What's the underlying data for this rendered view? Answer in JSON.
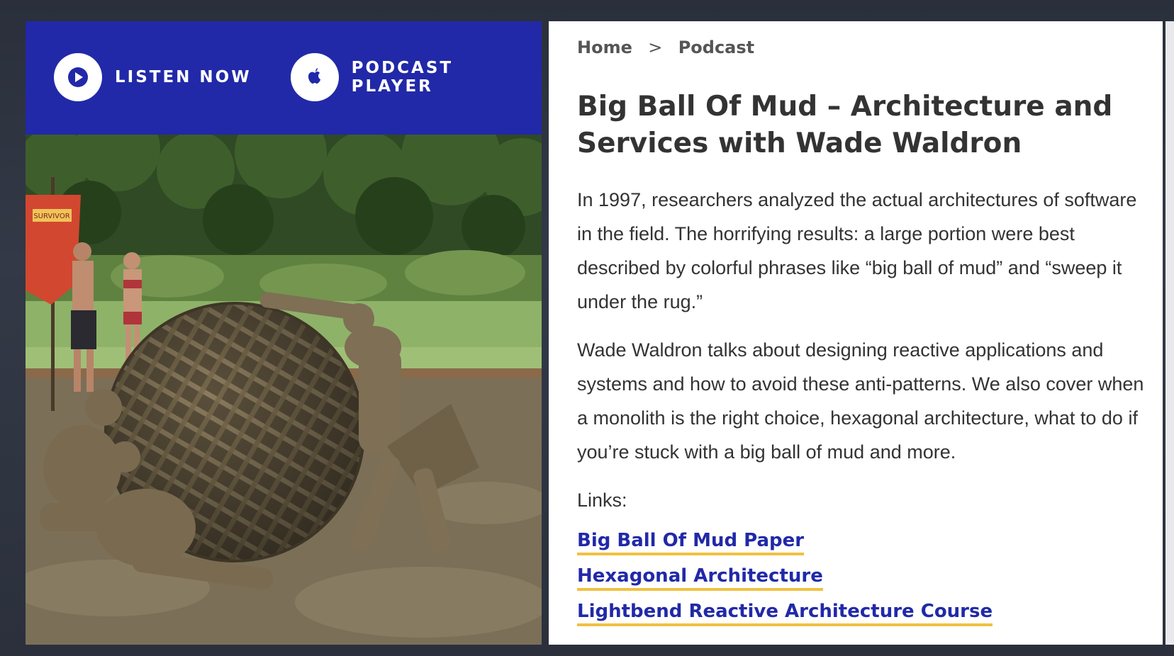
{
  "player": {
    "listen_label": "LISTEN NOW",
    "podcast_label": "PODCAST PLAYER",
    "accent_color": "#2129a8"
  },
  "breadcrumb": {
    "home": "Home",
    "separator": ">",
    "current": "Podcast"
  },
  "article": {
    "title": "Big Ball Of Mud – Architecture and Services with Wade Waldron",
    "paragraph1": "In 1997, researchers analyzed the actual architectures of software in the field. The horrifying results: a large portion were best described by colorful phrases like “big ball of mud” and “sweep it under the rug.”",
    "paragraph2": "Wade Waldron talks about designing reactive applications and systems and how to avoid these anti-patterns. We also cover when a monolith is the right choice, hexagonal architecture, what to do if you’re stuck with a big ball of mud and more.",
    "links_heading": "Links:",
    "links": [
      "Big Ball Of Mud Paper",
      "Hexagonal Architecture",
      "Lightbend Reactive Architecture Course"
    ],
    "link_underline_color": "#f0c040"
  },
  "photo": {
    "flag_text": "SURVIVOR"
  }
}
